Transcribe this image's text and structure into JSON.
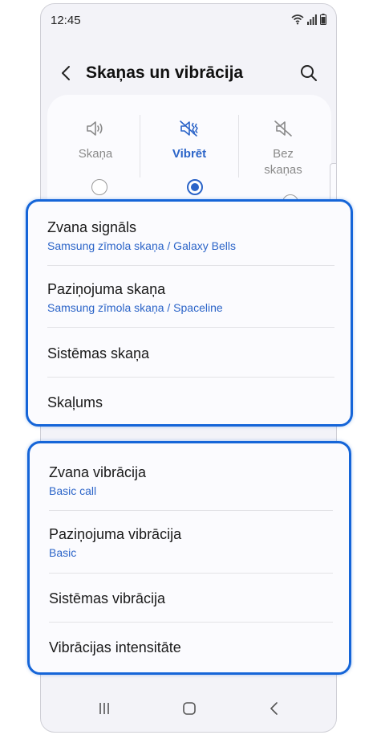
{
  "status_bar": {
    "time": "12:45",
    "icons": [
      "wifi-icon",
      "signal-icon",
      "battery-icon"
    ]
  },
  "header": {
    "title": "Skaņas un vibrācija",
    "back_icon": "chevron-left-icon",
    "search_icon": "search-icon"
  },
  "sound_modes": {
    "options": [
      {
        "label": "Skaņa",
        "icon": "speaker-icon",
        "selected": false
      },
      {
        "label": "Vibrēt",
        "icon": "vibrate-icon",
        "selected": true
      },
      {
        "label": "Bez skaņas",
        "icon": "mute-icon",
        "selected": false
      }
    ]
  },
  "sound_settings": {
    "items": [
      {
        "title": "Zvana signāls",
        "subtitle": "Samsung zīmola skaņa / Galaxy Bells"
      },
      {
        "title": "Paziņojuma skaņa",
        "subtitle": "Samsung zīmola skaņa / Spaceline"
      },
      {
        "title": "Sistēmas skaņa"
      },
      {
        "title": "Skaļums"
      }
    ]
  },
  "vibration_settings": {
    "items": [
      {
        "title": "Zvana vibrācija",
        "subtitle": "Basic call"
      },
      {
        "title": "Paziņojuma vibrācija",
        "subtitle": "Basic"
      },
      {
        "title": "Sistēmas vibrācija"
      },
      {
        "title": "Vibrācijas intensitāte"
      }
    ]
  },
  "nav_bar": {
    "buttons": [
      "recents-icon",
      "home-icon",
      "back-icon"
    ]
  },
  "colors": {
    "accent": "#2b64c8",
    "highlight_border": "#1565d8",
    "background": "#f3f3f8",
    "card": "#fbfbfe"
  }
}
